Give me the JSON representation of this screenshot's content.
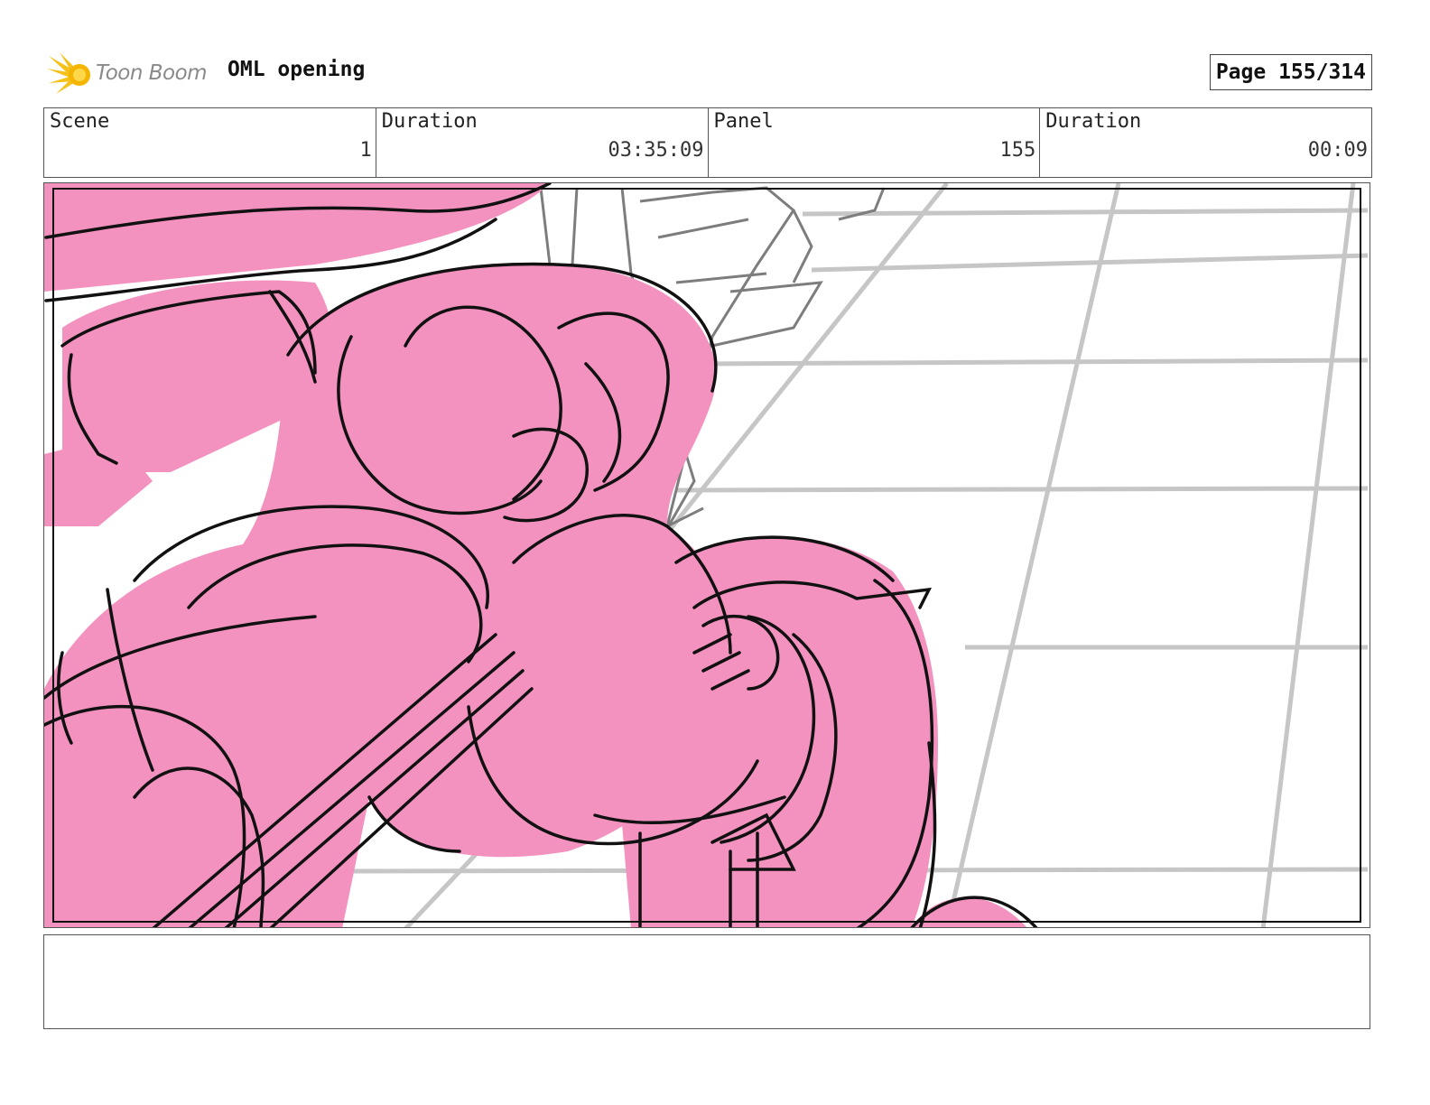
{
  "header": {
    "logo_text": "Toon Boom",
    "title": "OML opening",
    "page_label": "Page 155/314"
  },
  "info": {
    "scene_label": "Scene",
    "scene_value": "1",
    "duration_label": "Duration",
    "duration_value": "03:35:09",
    "panel_label": "Panel",
    "panel_value": "155",
    "panel_duration_label": "Duration",
    "panel_duration_value": "00:09"
  },
  "panel_image": {
    "icon": "storyboard-sketch",
    "colors": {
      "fill": "#f492bf",
      "line": "#111111",
      "background_lines": "#c4c4c4"
    }
  },
  "notes": {
    "text": ""
  }
}
